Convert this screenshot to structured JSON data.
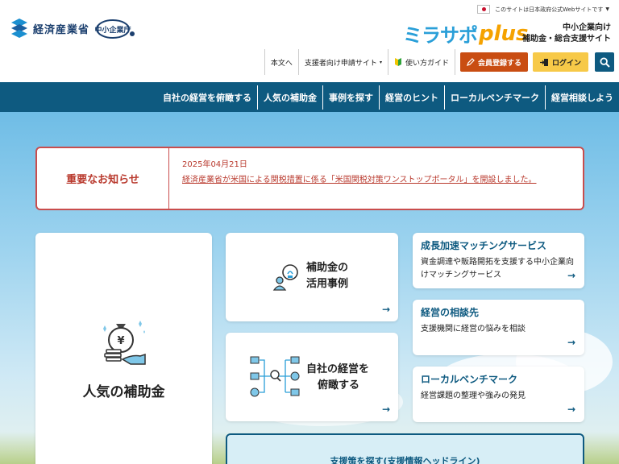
{
  "header": {
    "gov_notice": "このサイトは日本政府公式Webサイトです",
    "meti_logo_text": "経済産業省",
    "sme_logo_text": "中小企業庁",
    "brand_main": "ミラサポ",
    "brand_plus": "plus",
    "tagline_line1": "中小企業向け",
    "tagline_line2": "補助金・総合支援サイト"
  },
  "utility_nav": {
    "main_text": "本文へ",
    "supporter_site": "支援者向け申請サイト",
    "guide": "使い方ガイド",
    "register": "会員登録する",
    "login": "ログイン"
  },
  "global_nav": [
    "自社の経営を俯瞰する",
    "人気の補助金",
    "事例を探す",
    "経営のヒント",
    "ローカルベンチマーク",
    "経営相談しよう"
  ],
  "notice": {
    "heading": "重要なお知らせ",
    "date": "2025年04月21日",
    "link_text": "経済産業省が米国による関税措置に係る「米国関税対策ワンストップポータル」を開設しました。"
  },
  "cards": {
    "popular_subsidy": "人気の補助金",
    "subsidy_cases_line1": "補助金の",
    "subsidy_cases_line2": "活用事例",
    "overview_line1": "自社の経営を",
    "overview_line2": "俯瞰する",
    "matching_title": "成長加速マッチングサービス",
    "matching_desc": "資金調達や販路開拓を支援する中小企業向けマッチングサービス",
    "consult_title": "経営の相談先",
    "consult_desc": "支援機関に経営の悩みを相談",
    "benchmark_title": "ローカルベンチマーク",
    "benchmark_desc": "経営課題の整理や強みの発見",
    "arrow": "→"
  },
  "headline": {
    "title": "支援策を探す(支援情報ヘッドライン)"
  },
  "colors": {
    "nav_blue": "#0e5a80",
    "register_orange": "#c94d12",
    "login_yellow": "#f7c948",
    "notice_red": "#b93a2e",
    "brand_blue": "#2a9fd8",
    "brand_orange": "#f5a200"
  },
  "icons": [
    "japan-flag-icon",
    "meti-logo-icon",
    "sme-agency-logo-icon",
    "beginner-mark-icon",
    "pencil-icon",
    "login-door-icon",
    "search-icon",
    "money-bag-hand-icon",
    "person-idea-icon",
    "overview-network-icon",
    "arrow-right-icon"
  ]
}
